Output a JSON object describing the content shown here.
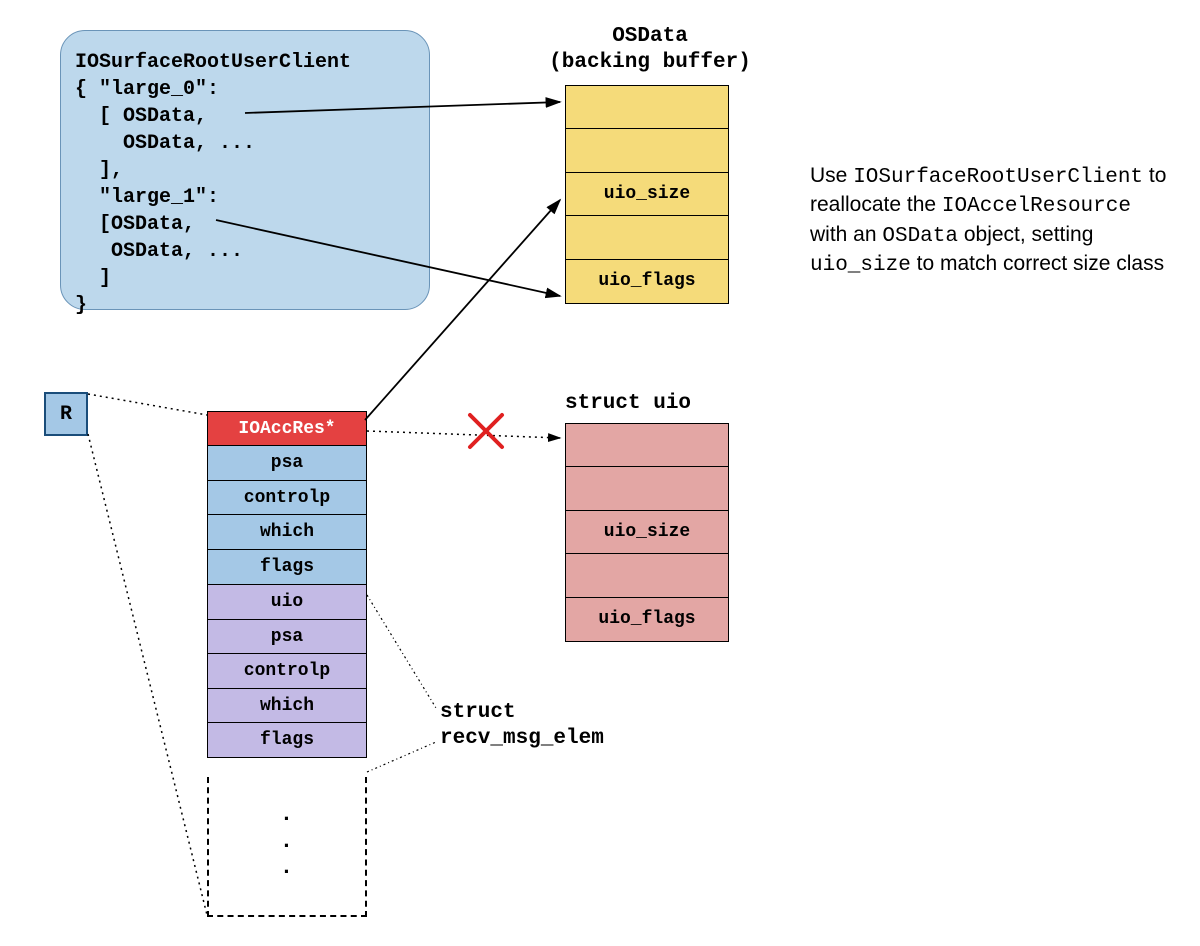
{
  "codebox": {
    "title": "IOSurfaceRootUserClient",
    "lines": [
      "IOSurfaceRootUserClient",
      "{ \"large_0\":",
      "  [ OSData,",
      "    OSData, ...",
      "  ],",
      "  \"large_1\":",
      "  [OSData,",
      "   OSData, ...",
      "  ]",
      "}"
    ]
  },
  "r_box": "R",
  "stack": {
    "group1": [
      {
        "text": "IOAccRes*",
        "color": "red"
      },
      {
        "text": "psa",
        "color": "blue"
      },
      {
        "text": "controlp",
        "color": "blue"
      },
      {
        "text": "which",
        "color": "blue"
      },
      {
        "text": "flags",
        "color": "blue"
      }
    ],
    "group2": [
      {
        "text": "uio",
        "color": "purple"
      },
      {
        "text": "psa",
        "color": "purple"
      },
      {
        "text": "controlp",
        "color": "purple"
      },
      {
        "text": "which",
        "color": "purple"
      },
      {
        "text": "flags",
        "color": "purple"
      }
    ],
    "continuation_dots": [
      "·",
      "·",
      "·"
    ]
  },
  "osdata": {
    "title_line1": "OSData",
    "title_line2": "(backing buffer)",
    "cells": [
      "",
      "",
      "uio_size",
      "",
      "uio_flags"
    ]
  },
  "uio": {
    "title": "struct uio",
    "cells": [
      "",
      "",
      "uio_size",
      "",
      "uio_flags"
    ]
  },
  "recv_label_line1": "struct",
  "recv_label_line2": "recv_msg_elem",
  "explain": {
    "parts": [
      {
        "t": "Use ",
        "mono": false
      },
      {
        "t": "IOSurfaceRootUserClient",
        "mono": true
      },
      {
        "t": " to reallocate the ",
        "mono": false
      },
      {
        "t": "IOAccelResource",
        "mono": true
      },
      {
        "t": " with an ",
        "mono": false
      },
      {
        "t": "OSData",
        "mono": true
      },
      {
        "t": " object, setting ",
        "mono": false
      },
      {
        "t": "uio_size",
        "mono": true
      },
      {
        "t": " to match correct size class",
        "mono": false
      }
    ]
  },
  "colors": {
    "codebox_bg": "#bdd8ec",
    "blue_cell": "#a4c8e6",
    "red_cell": "#e44141",
    "purple_cell": "#c3bae5",
    "yellow_cell": "#f5db7a",
    "pink_cell": "#e3a6a4"
  }
}
